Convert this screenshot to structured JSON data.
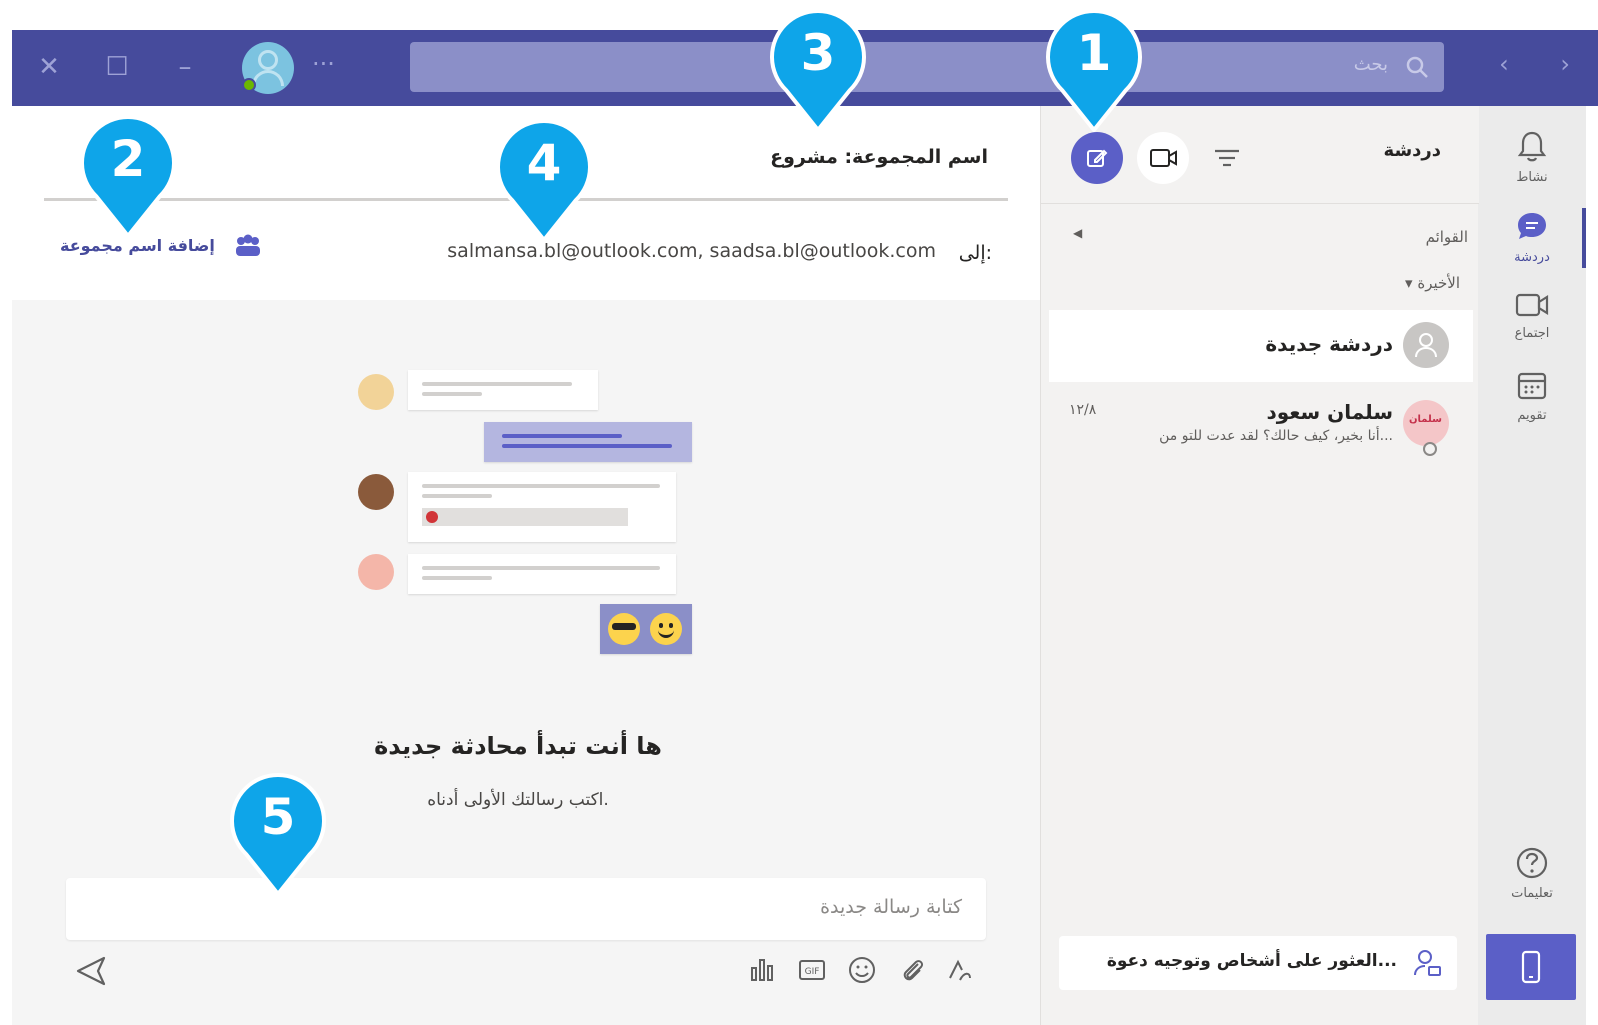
{
  "titlebar": {
    "search_placeholder": "بحث",
    "more": "···"
  },
  "rail": {
    "items": [
      {
        "label": "نشاط",
        "icon": "bell-icon"
      },
      {
        "label": "دردشة",
        "icon": "chat-icon"
      },
      {
        "label": "اجتماع",
        "icon": "video-icon"
      },
      {
        "label": "تقويم",
        "icon": "calendar-icon"
      },
      {
        "label": "تعليمات",
        "icon": "help-icon"
      }
    ]
  },
  "list": {
    "title": "دردشة",
    "pinned": "القوائم",
    "recent": "الأخيرة",
    "chats": [
      {
        "name": "دردشة جديدة"
      },
      {
        "name": "سلمان سعود",
        "preview": "أنا بخير، كيف حالك؟ لقد عدت للتو من...",
        "time": "١٢/٨",
        "avatar_text": "سلمان"
      }
    ],
    "find_people": "العثور على أشخاص وتوجيه دعوة..."
  },
  "conversation": {
    "group_name": "اسم المجموعة: مشروع",
    "to_label": "إلى:",
    "to_value": "salmansa.bl@outlook.com, saadsa.bl@outlook.com",
    "add_group_name": "إضافة اسم مجموعة",
    "empty_title": "ها أنت تبدأ محادثة جديدة",
    "empty_subtitle": "اكتب رسالتك الأولى أدناه.",
    "composer_placeholder": "كتابة رسالة جديدة"
  },
  "callouts": [
    "1",
    "2",
    "3",
    "4",
    "5"
  ],
  "colors": {
    "brand": "#464b9c",
    "accent": "#5b5fc7",
    "callout": "#0ea5e9"
  }
}
